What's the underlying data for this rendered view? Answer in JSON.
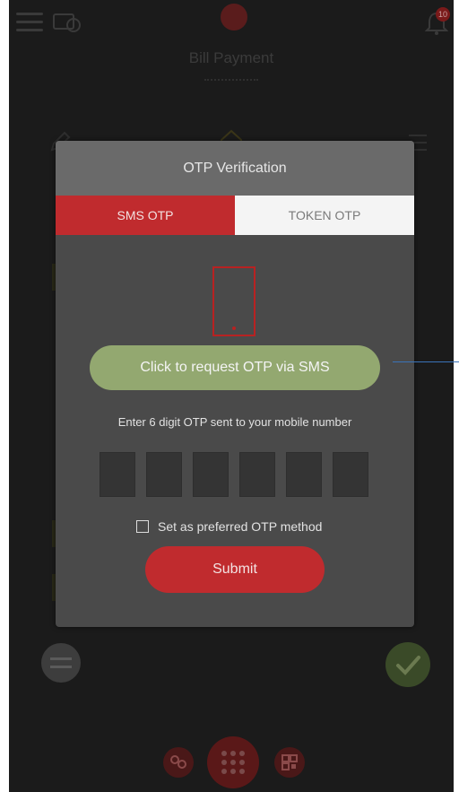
{
  "background": {
    "title": "Bill Payment",
    "notification_count": "10"
  },
  "modal": {
    "title": "OTP Verification",
    "tabs": [
      {
        "label": "SMS OTP",
        "active": true
      },
      {
        "label": "TOKEN OTP",
        "active": false
      }
    ],
    "request_button": "Click to request OTP via SMS",
    "instruction": "Enter 6 digit OTP sent to your mobile number",
    "otp_digits": [
      "",
      "",
      "",
      "",
      "",
      ""
    ],
    "preferred_label": "Set as preferred OTP method",
    "preferred_checked": false,
    "submit_label": "Submit"
  },
  "colors": {
    "accent_red": "#c02b2e",
    "request_green": "#93a870",
    "modal_bg": "#4a4a4a",
    "header_bg": "#6a6a6a"
  },
  "icons": [
    "menu-icon",
    "bill-icon",
    "bell-icon",
    "phone-icon",
    "back-icon",
    "check-icon",
    "apps-grid-icon",
    "contacts-icon",
    "qr-icon"
  ]
}
